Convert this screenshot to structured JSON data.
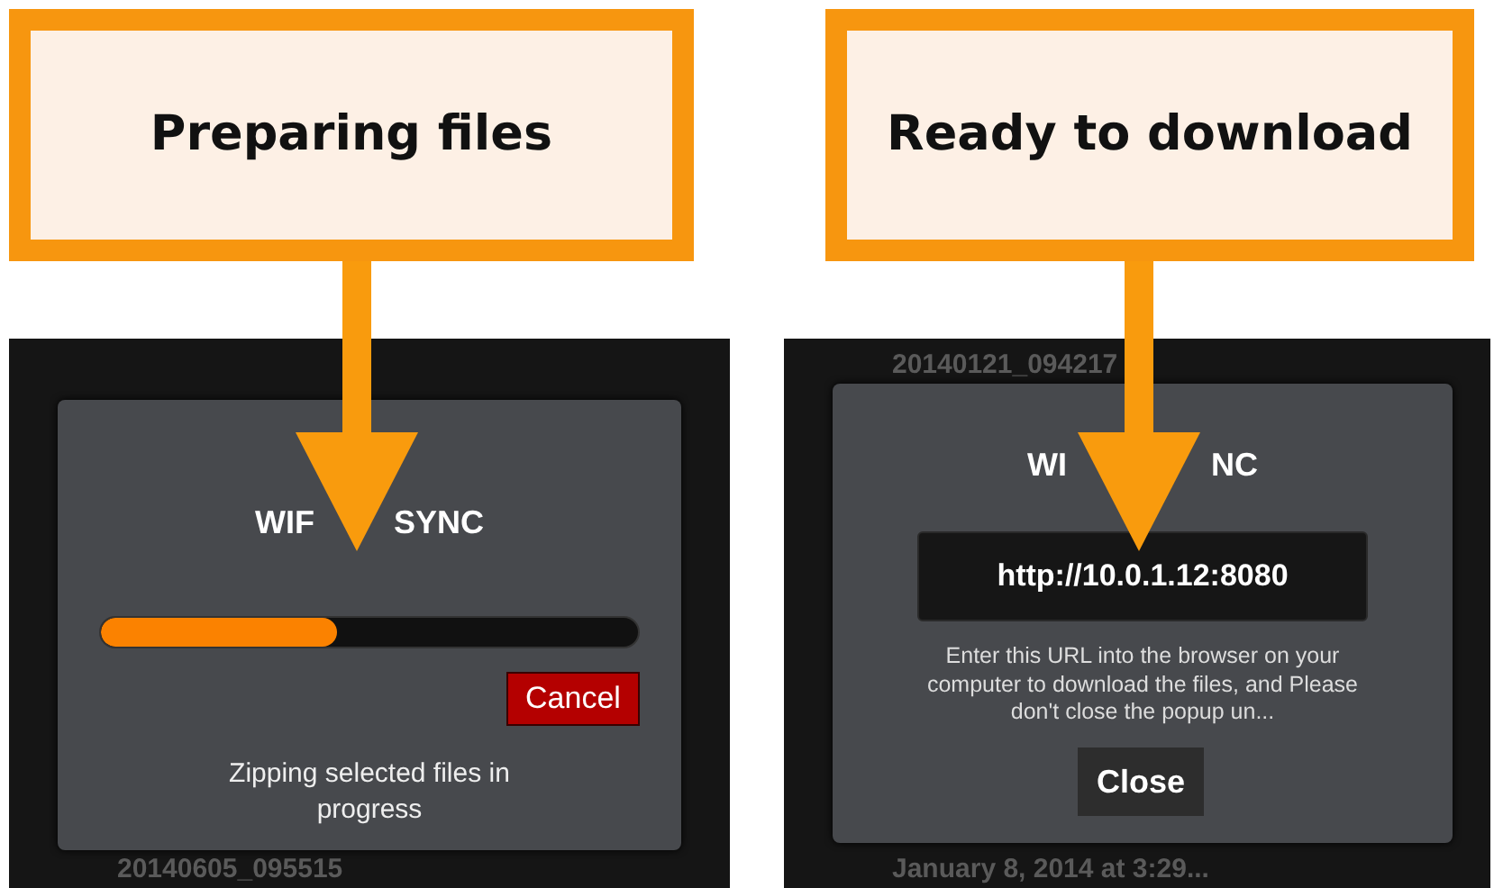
{
  "panels": [
    {
      "callout": "Preparing files",
      "row_below": "20140605_095515",
      "dialog": {
        "kind": "progress",
        "title_parts": [
          "WIF",
          "SYNC"
        ],
        "level": 0.44,
        "button": "Cancel",
        "message": "Zipping selected files in progress"
      }
    },
    {
      "callout": "Ready to download",
      "row_above": "20140121_094217",
      "row_below": "January 8, 2014 at 3:29...",
      "dialog": {
        "kind": "url",
        "title_parts": [
          "WI",
          "NC"
        ],
        "url": "http://10.0.1.12:8080",
        "message": "Enter this URL into the browser on your computer to download the files, and Please don't close the popup un...",
        "button": "Close"
      }
    }
  ]
}
